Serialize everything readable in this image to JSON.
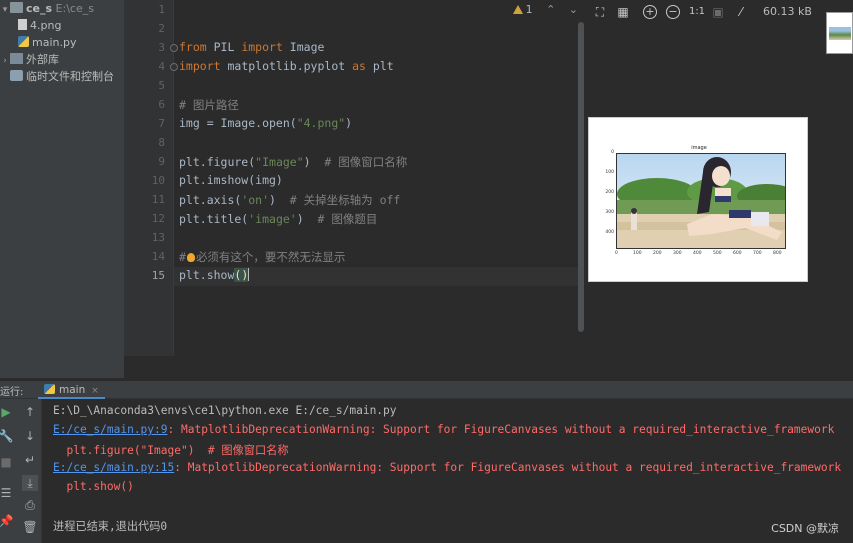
{
  "project": {
    "root_name": "ce_s",
    "root_path": "E:\\ce_s",
    "files": [
      "4.png",
      "main.py"
    ],
    "external_libs": "外部库",
    "scratches": "临时文件和控制台"
  },
  "editor": {
    "warning_count": "1",
    "line_numbers": [
      "1",
      "2",
      "3",
      "4",
      "5",
      "6",
      "7",
      "8",
      "9",
      "10",
      "11",
      "12",
      "13",
      "14",
      "15"
    ],
    "lines": {
      "l3_kw1": "from",
      "l3_mod": " PIL ",
      "l3_kw2": "import",
      "l3_name": " Image",
      "l4_kw1": "import",
      "l4_mod": " matplotlib.pyplot ",
      "l4_kw2": "as",
      "l4_name": " plt",
      "l6": "# 图片路径",
      "l7_a": "img = Image.open(",
      "l7_s": "\"4.png\"",
      "l7_b": ")",
      "l9_a": "plt.figure(",
      "l9_s": "\"Image\"",
      "l9_b": ")  ",
      "l9_c": "# 图像窗口名称",
      "l10": "plt.imshow(img)",
      "l11_a": "plt.axis(",
      "l11_s": "'on'",
      "l11_b": ")  ",
      "l11_c": "# 关掉坐标轴为 off",
      "l12_a": "plt.title(",
      "l12_s": "'image'",
      "l12_b": ")  ",
      "l12_c": "# 图像题目",
      "l14_a": "#",
      "l14_b": "必须有这个，要不然无法显示",
      "l15_a": "plt.show",
      "l15_p1": "(",
      "l15_p2": ")"
    }
  },
  "viewer": {
    "zoom_label": "1:1",
    "file_size": "60.13 kB",
    "plot_title": "image",
    "y_ticks": [
      "0",
      "100",
      "200",
      "300",
      "400"
    ],
    "x_ticks": [
      "0",
      "100",
      "200",
      "300",
      "400",
      "500",
      "600",
      "700",
      "800"
    ]
  },
  "run": {
    "label": "运行:",
    "tab_name": "main",
    "console": {
      "cmd": "E:\\D_\\Anaconda3\\envs\\ce1\\python.exe E:/ce_s/main.py",
      "w1_link": "E:/ce_s/main.py:9",
      "w1_msg": ": MatplotlibDeprecationWarning: Support for FigureCanvases without a required_interactive_framework",
      "w1_code": "  plt.figure(\"Image\")  # 图像窗口名称",
      "w2_link": "E:/ce_s/main.py:15",
      "w2_msg": ": MatplotlibDeprecationWarning: Support for FigureCanvases without a required_interactive_framework",
      "w2_code": "  plt.show()",
      "exit": "进程已结束,退出代码0"
    }
  },
  "watermark": "CSDN @默凉"
}
